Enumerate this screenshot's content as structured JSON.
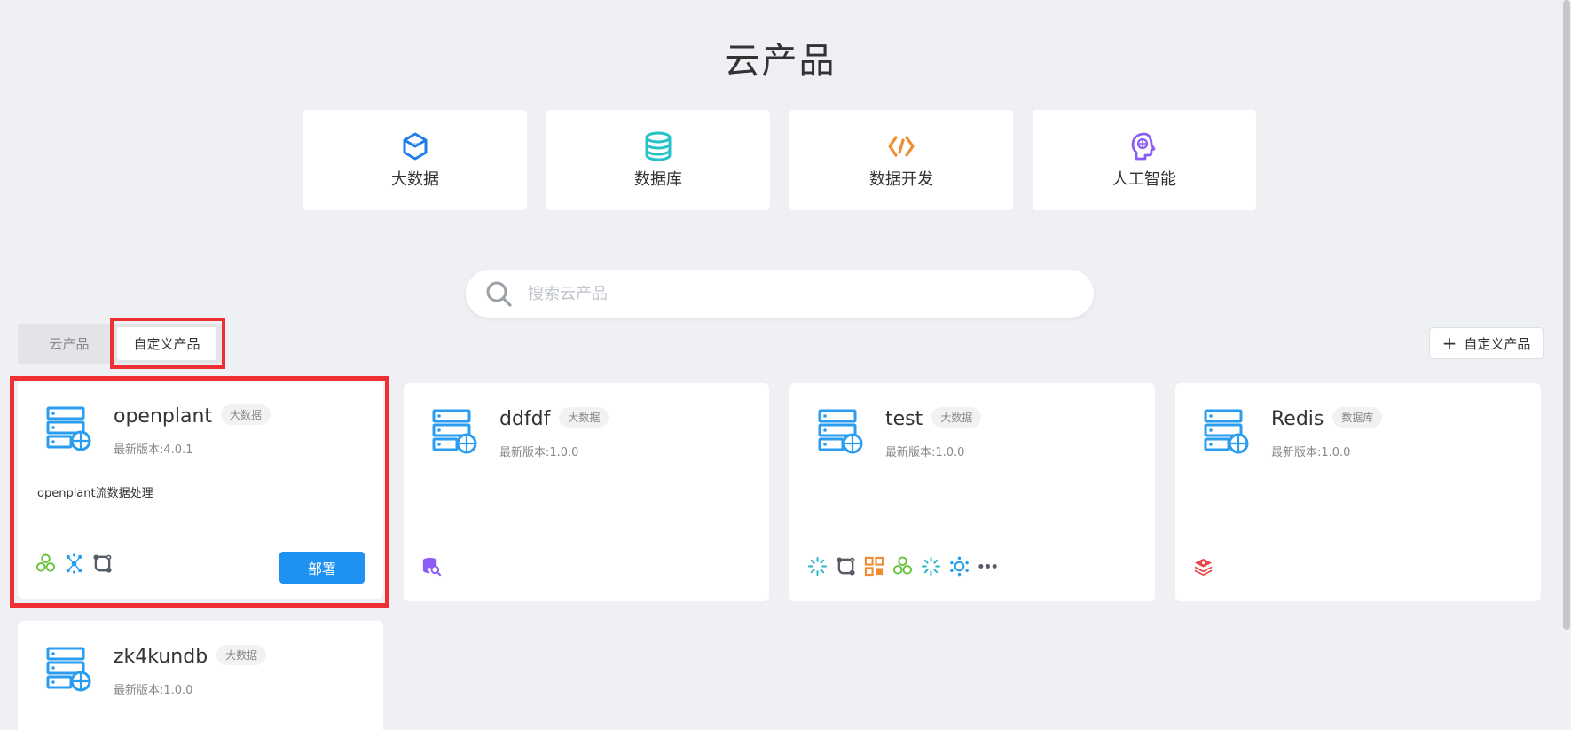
{
  "page": {
    "title": "云产品"
  },
  "categories": [
    {
      "label": "大数据",
      "icon": "cube-icon",
      "color": "#1f7ee8"
    },
    {
      "label": "数据库",
      "icon": "database-icon",
      "color": "#23c2c6"
    },
    {
      "label": "数据开发",
      "icon": "code-icon",
      "color": "#f08c31"
    },
    {
      "label": "人工智能",
      "icon": "brain-icon",
      "color": "#8b5cf6"
    }
  ],
  "search": {
    "placeholder": "搜索云产品",
    "value": ""
  },
  "tabs": [
    {
      "label": "云产品",
      "active": false
    },
    {
      "label": "自定义产品",
      "active": true
    }
  ],
  "actions": {
    "add_custom_label": "自定义产品"
  },
  "products": [
    {
      "name": "openplant",
      "tag": "大数据",
      "version": "最新版本:4.0.1",
      "description": "openplant流数据处理",
      "deploy_label": "部署",
      "icons": [
        "hexagons-icon",
        "nodes-icon",
        "cycle-icon"
      ]
    },
    {
      "name": "ddfdf",
      "tag": "大数据",
      "version": "最新版本:1.0.0",
      "description": "",
      "icons": [
        "db-search-icon"
      ]
    },
    {
      "name": "test",
      "tag": "大数据",
      "version": "最新版本:1.0.0",
      "description": "",
      "icons": [
        "spark-icon",
        "cycle-icon",
        "grid-icon",
        "hexagons-icon",
        "spark-icon",
        "atom-icon",
        "more-icon"
      ]
    },
    {
      "name": "Redis",
      "tag": "数据库",
      "version": "最新版本:1.0.0",
      "description": "",
      "icons": [
        "redis-icon"
      ]
    },
    {
      "name": "zk4kundb",
      "tag": "大数据",
      "version": "最新版本:1.0.0",
      "description": "",
      "icons": []
    }
  ],
  "colors": {
    "background": "#eef0f3",
    "primary": "#1f92f1",
    "highlight": "#ee2f33",
    "server_icon": "#2a9df0"
  }
}
